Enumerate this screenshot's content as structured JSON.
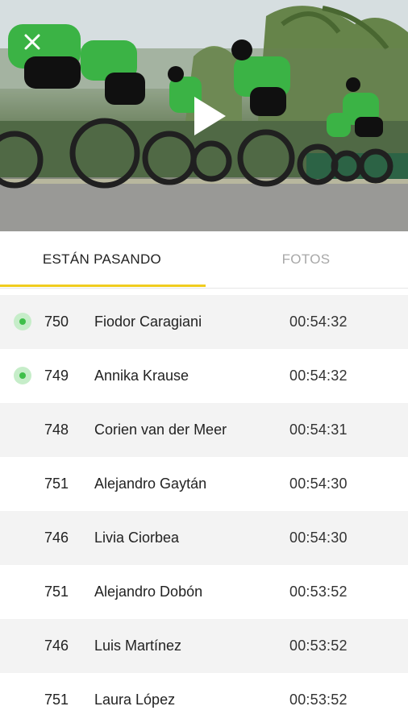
{
  "video": {
    "close_icon": "close-icon",
    "play_icon": "play-icon"
  },
  "tabs": [
    {
      "label": "ESTÁN PASANDO",
      "active": true
    },
    {
      "label": "FOTOS",
      "active": false
    }
  ],
  "colors": {
    "accent": "#f0cc1e",
    "live_dot": "#3fbf4a",
    "live_dot_ring": "#c6edc9",
    "row_alt": "#f3f3f3"
  },
  "riders": [
    {
      "bib": "750",
      "name": "Fiodor Caragiani",
      "time": "00:54:32",
      "live": true
    },
    {
      "bib": "749",
      "name": "Annika Krause",
      "time": "00:54:32",
      "live": true
    },
    {
      "bib": "748",
      "name": "Corien van der Meer",
      "time": "00:54:31",
      "live": false
    },
    {
      "bib": "751",
      "name": "Alejandro Gaytán",
      "time": "00:54:30",
      "live": false
    },
    {
      "bib": "746",
      "name": "Livia Ciorbea",
      "time": "00:54:30",
      "live": false
    },
    {
      "bib": "751",
      "name": "Alejandro Dobón",
      "time": "00:53:52",
      "live": false
    },
    {
      "bib": "746",
      "name": "Luis Martínez",
      "time": "00:53:52",
      "live": false
    },
    {
      "bib": "751",
      "name": "Laura López",
      "time": "00:53:52",
      "live": false
    }
  ]
}
